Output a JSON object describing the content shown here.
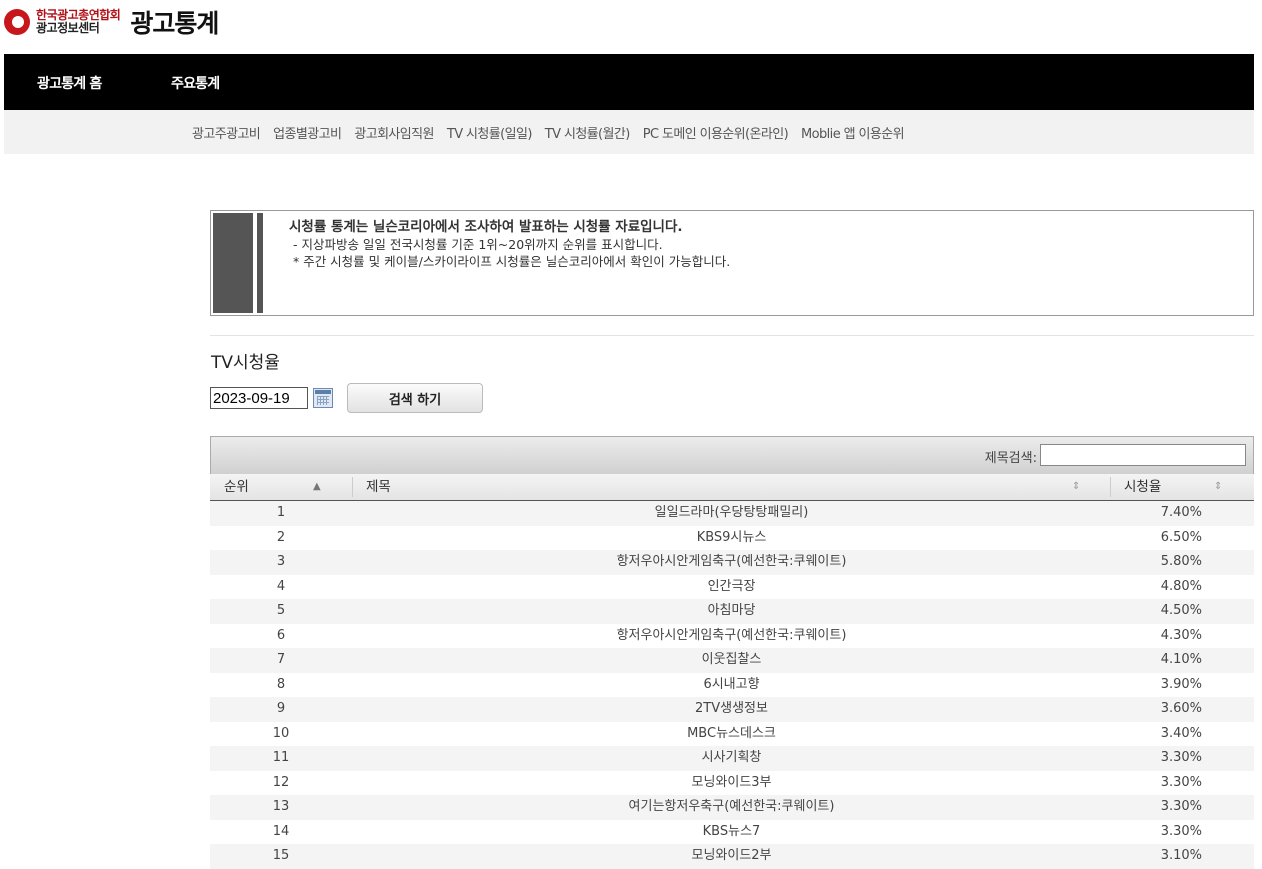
{
  "header": {
    "org_line1": "한국광고총연합회",
    "org_line2": "광고정보센터",
    "site_title": "광고통계"
  },
  "topnav": {
    "home": "광고통계 홈",
    "main": "주요통계"
  },
  "subnav": [
    "광고주광고비",
    "업종별광고비",
    "광고회사임직원",
    "TV 시청률(일일)",
    "TV 시청률(월간)",
    "PC 도메인 이용순위(온라인)",
    "Moblie 앱 이용순위"
  ],
  "notice": {
    "head": "시청률 통계는 닐슨코리아에서 조사하여 발표하는 시청률 자료입니다.",
    "line1": " - 지상파방송 일일 전국시청률 기준 1위~20위까지 순위를 표시합니다.",
    "line2": " * 주간 시청률 및 케이블/스카이라이프 시청률은 닐슨코리아에서 확인이 가능합니다."
  },
  "section_title": "TV시청율",
  "search": {
    "date": "2023-09-19",
    "button": "검색 하기"
  },
  "table": {
    "filter_label": "제목검색:",
    "columns": {
      "rank": "순위",
      "title": "제목",
      "rate": "시청율"
    },
    "rows": [
      {
        "rank": "1",
        "title": "일일드라마(우당탕탕패밀리)",
        "rate": "7.40%"
      },
      {
        "rank": "2",
        "title": "KBS9시뉴스",
        "rate": "6.50%"
      },
      {
        "rank": "3",
        "title": "항저우아시안게임축구(예선한국:쿠웨이트)",
        "rate": "5.80%"
      },
      {
        "rank": "4",
        "title": "인간극장",
        "rate": "4.80%"
      },
      {
        "rank": "5",
        "title": "아침마당",
        "rate": "4.50%"
      },
      {
        "rank": "6",
        "title": "항저우아시안게임축구(예선한국:쿠웨이트)",
        "rate": "4.30%"
      },
      {
        "rank": "7",
        "title": "이웃집찰스",
        "rate": "4.10%"
      },
      {
        "rank": "8",
        "title": "6시내고향",
        "rate": "3.90%"
      },
      {
        "rank": "9",
        "title": "2TV생생정보",
        "rate": "3.60%"
      },
      {
        "rank": "10",
        "title": "MBC뉴스데스크",
        "rate": "3.40%"
      },
      {
        "rank": "11",
        "title": "시사기획창",
        "rate": "3.30%"
      },
      {
        "rank": "12",
        "title": "모닝와이드3부",
        "rate": "3.30%"
      },
      {
        "rank": "13",
        "title": "여기는항저우축구(예선한국:쿠웨이트)",
        "rate": "3.30%"
      },
      {
        "rank": "14",
        "title": "KBS뉴스7",
        "rate": "3.30%"
      },
      {
        "rank": "15",
        "title": "모닝와이드2부",
        "rate": "3.10%"
      }
    ]
  }
}
